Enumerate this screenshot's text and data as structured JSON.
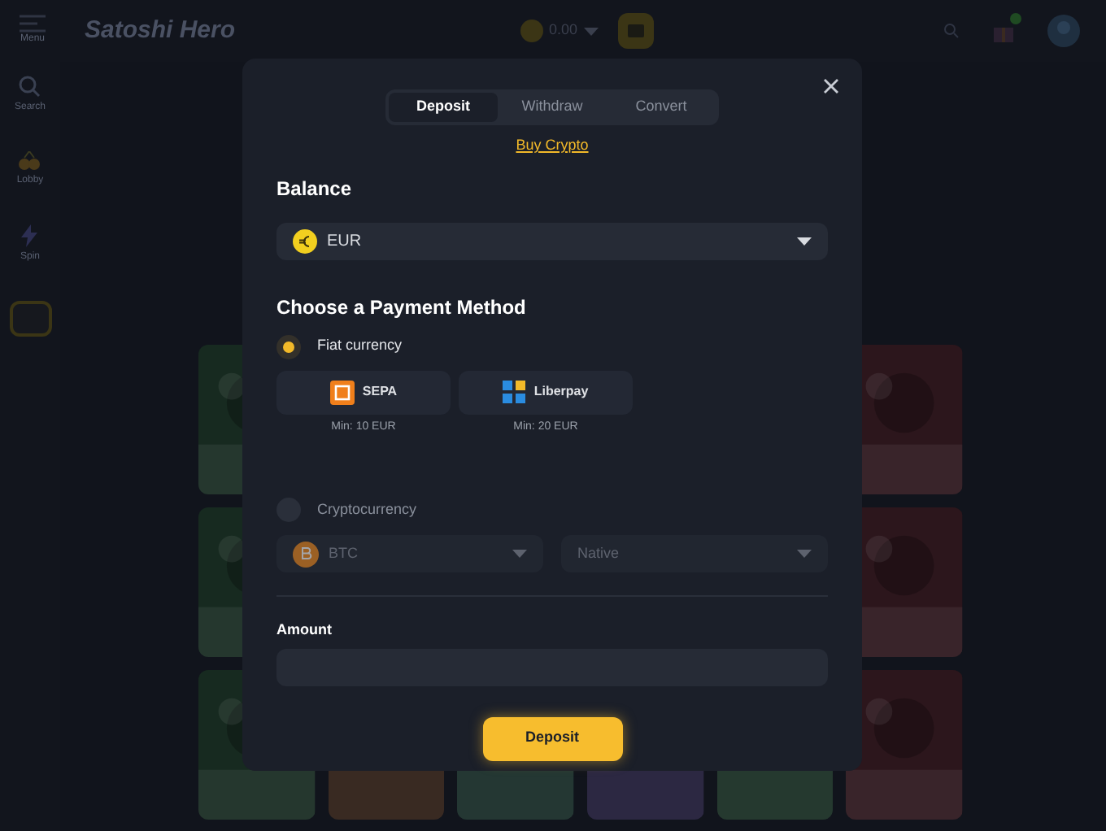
{
  "header": {
    "menu_label": "Menu",
    "logo": "Satoshi Hero",
    "balance": "0.00",
    "has_notification": true
  },
  "sidebar": {
    "items": [
      {
        "label": "Search",
        "kind": "search"
      },
      {
        "label": "Lobby",
        "kind": "lobby"
      },
      {
        "label": "Spin",
        "kind": "spin"
      }
    ]
  },
  "modal": {
    "tabs": [
      {
        "label": "Deposit",
        "selected": true
      },
      {
        "label": "Withdraw",
        "selected": false
      },
      {
        "label": "Convert",
        "selected": false
      }
    ],
    "buy_crypto_link": "Buy Crypto",
    "balance_label": "Balance",
    "currency": "EUR",
    "payment_title": "Choose a Payment Method",
    "methods": [
      {
        "kind": "fiat",
        "label": "Fiat currency",
        "selected": true,
        "options": [
          {
            "name": "SEPA",
            "min": "Min: 10 EUR",
            "kind": "square"
          },
          {
            "name": "Liberpay",
            "min": "Min: 20 EUR",
            "kind": "blocks"
          }
        ]
      },
      {
        "kind": "crypto",
        "label": "Cryptocurrency",
        "selected": false,
        "coin": "BTC",
        "network": "Native"
      }
    ],
    "amount_label": "Amount",
    "submit": "Deposit"
  }
}
